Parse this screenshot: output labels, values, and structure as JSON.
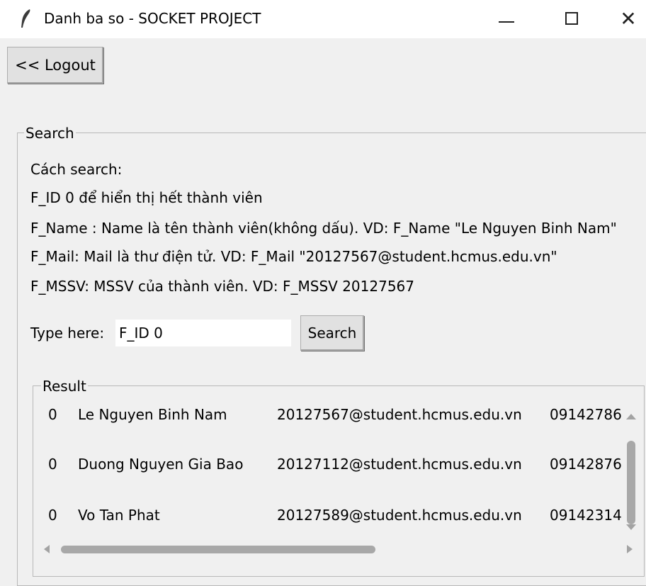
{
  "window": {
    "title": "Danh ba so - SOCKET PROJECT",
    "icon": "feather-icon",
    "controls": {
      "minimize_icon": "minimize-icon",
      "maximize_icon": "maximize-icon",
      "close": "✕"
    }
  },
  "toolbar": {
    "logout_label": "<< Logout"
  },
  "search": {
    "legend": "Search",
    "instructions": [
      "Cách search:",
      "F_ID 0 để hiển thị hết thành viên",
      "F_Name : Name là tên thành viên(không dấu). VD: F_Name \"Le Nguyen Binh Nam\"",
      "F_Mail: Mail là thư điện tử. VD: F_Mail \"20127567@student.hcmus.edu.vn\"",
      "F_MSSV: MSSV của thành viên. VD: F_MSSV 20127567"
    ],
    "type_label": "Type here:",
    "input_value": "F_ID 0",
    "button_label": "Search"
  },
  "result": {
    "legend": "Result",
    "rows": [
      {
        "id": "0",
        "name": "Le Nguyen Binh Nam",
        "email": "20127567@student.hcmus.edu.vn",
        "phone": "09142786"
      },
      {
        "id": "0",
        "name": "Duong Nguyen Gia Bao",
        "email": "20127112@student.hcmus.edu.vn",
        "phone": "09142876"
      },
      {
        "id": "0",
        "name": "Vo Tan Phat",
        "email": "20127589@student.hcmus.edu.vn",
        "phone": "09142314"
      }
    ]
  },
  "colors": {
    "window_bg": "#f0f0f0",
    "titlebar_bg": "#ffffff",
    "scroll_thumb": "#a8a8a8",
    "button_bg": "#e1e1e1"
  }
}
